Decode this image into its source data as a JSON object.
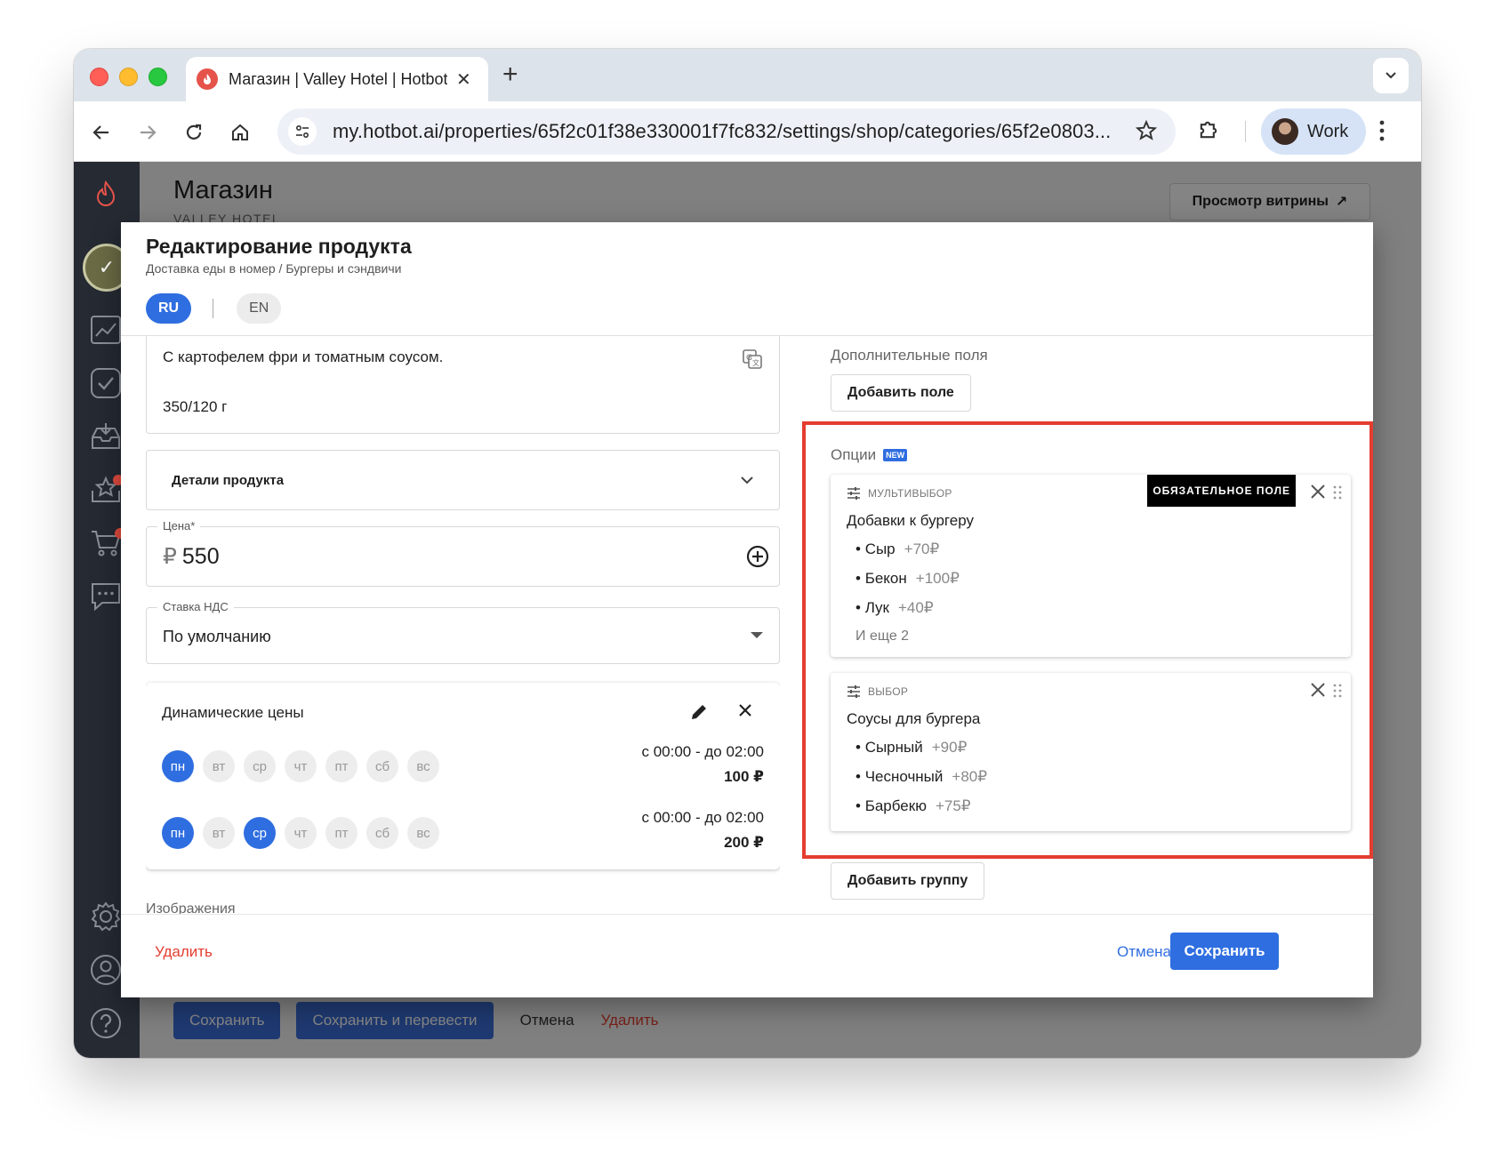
{
  "browser": {
    "tab_title": "Магазин | Valley Hotel | Hotbot",
    "url": "my.hotbot.ai/properties/65f2c01f38e330001f7fc832/settings/shop/categories/65f2e0803...",
    "profile_label": "Work"
  },
  "page": {
    "title": "Магазин",
    "subtitle": "VALLEY HOTEL",
    "preview_button": "Просмотр витрины",
    "footer": {
      "save": "Сохранить",
      "save_translate": "Сохранить и перевести",
      "cancel": "Отмена",
      "delete": "Удалить"
    }
  },
  "modal": {
    "title": "Редактирование продукта",
    "breadcrumb": "Доставка еды в номер / Бургеры и сэндвичи",
    "languages": [
      "RU",
      "EN"
    ],
    "description_line1": "С картофелем фри и томатным соусом.",
    "description_line2": "350/120 г",
    "details_label": "Детали продукта",
    "price": {
      "label": "Цена*",
      "currency": "₽",
      "value": "550"
    },
    "vat": {
      "label": "Ставка НДС",
      "value": "По умолчанию"
    },
    "dynamic_prices": {
      "title": "Динамические цены",
      "days": [
        "пн",
        "вт",
        "ср",
        "чт",
        "пт",
        "сб",
        "вс"
      ],
      "rules": [
        {
          "active_days": [
            0
          ],
          "time": "с 00:00 - до 02:00",
          "amount": "100 ₽"
        },
        {
          "active_days": [
            0,
            2
          ],
          "time": "с 00:00 - до 02:00",
          "amount": "200 ₽"
        }
      ]
    },
    "images_label": "Изображения",
    "extra_fields": {
      "label": "Дополнительные поля",
      "add_button": "Добавить поле"
    },
    "options": {
      "label": "Опции",
      "new_badge": "NEW",
      "groups": [
        {
          "type": "МУЛЬТИВЫБОР",
          "name": "Добавки к бургеру",
          "required_tag": "ОБЯЗАТЕЛЬНОЕ ПОЛЕ",
          "items": [
            {
              "name": "Сыр",
              "price": "+70₽"
            },
            {
              "name": "Бекон",
              "price": "+100₽"
            },
            {
              "name": "Лук",
              "price": "+40₽"
            }
          ],
          "more": "И еще 2"
        },
        {
          "type": "ВЫБОР",
          "name": "Соусы для бургера",
          "items": [
            {
              "name": "Сырный",
              "price": "+90₽"
            },
            {
              "name": "Чесночный",
              "price": "+80₽"
            },
            {
              "name": "Барбекю",
              "price": "+75₽"
            }
          ]
        }
      ],
      "add_group_button": "Добавить группу"
    },
    "footer": {
      "delete": "Удалить",
      "cancel": "Отмена",
      "save": "Сохранить"
    }
  },
  "colors": {
    "accent": "#2f6ee0",
    "danger": "#e43d30",
    "sidebar": "#252a33",
    "highlight": "#e43d30"
  }
}
